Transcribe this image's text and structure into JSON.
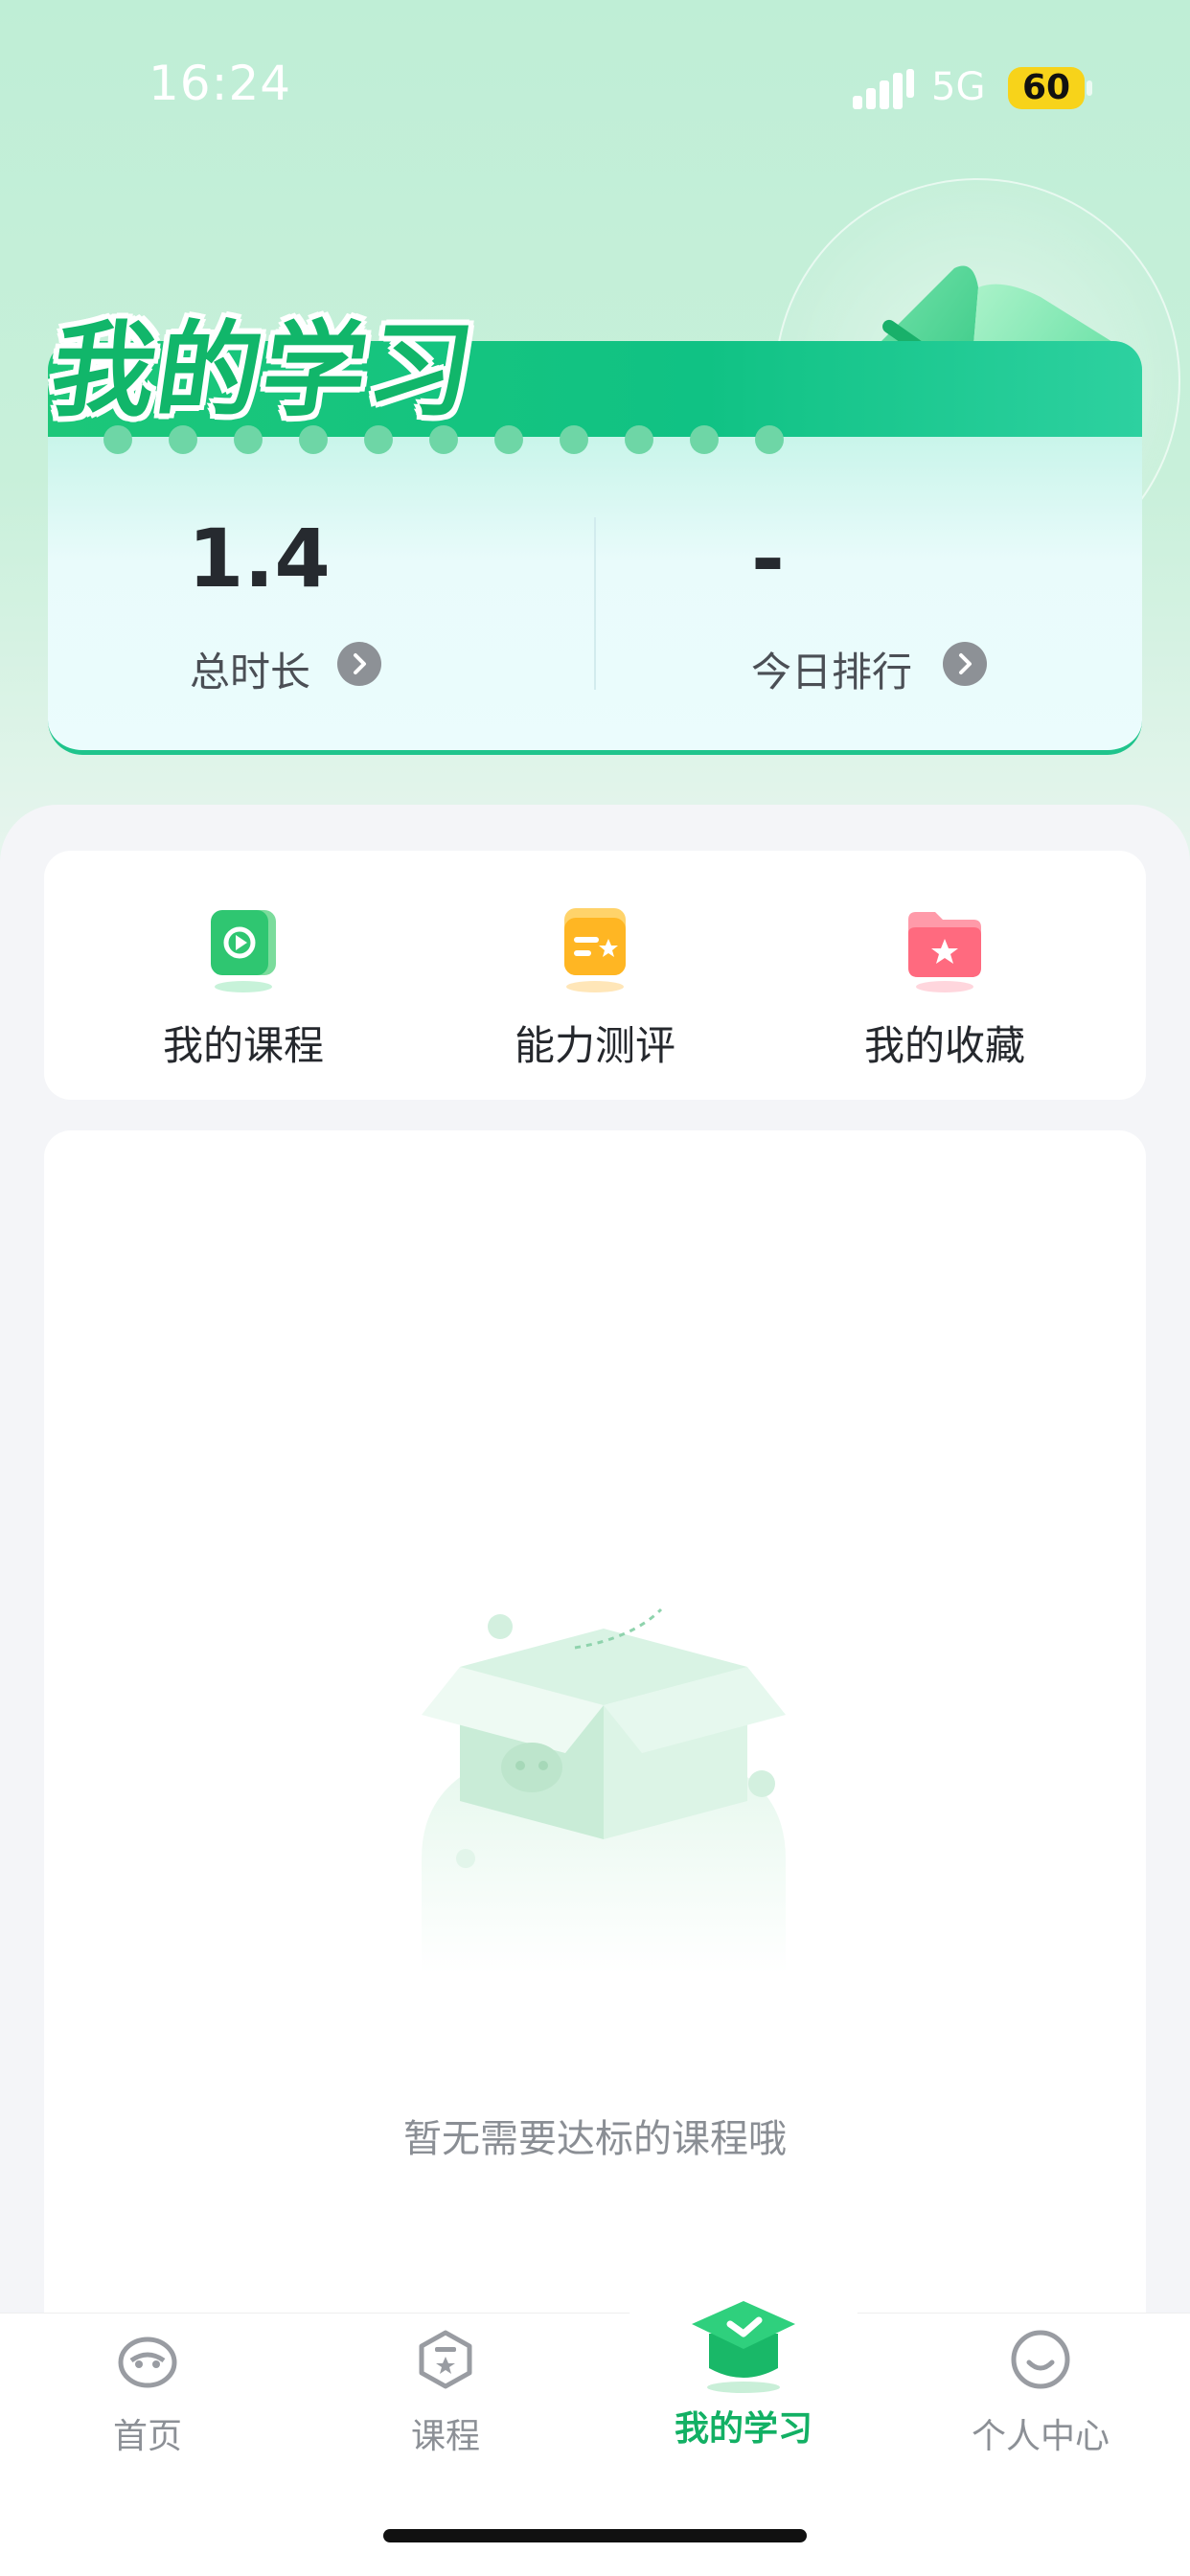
{
  "status_bar": {
    "time": "16:24",
    "network": "5G",
    "battery": "60"
  },
  "header": {
    "title": "我的学习",
    "stats": [
      {
        "value": "1.4",
        "label": "总时长"
      },
      {
        "value": "-",
        "label": "今日排行"
      }
    ]
  },
  "quick_actions": [
    {
      "label": "我的课程",
      "icon": "video-play-icon",
      "color": "#2fc671"
    },
    {
      "label": "能力测评",
      "icon": "evaluation-icon",
      "color": "#ffb623"
    },
    {
      "label": "我的收藏",
      "icon": "favorite-folder-icon",
      "color": "#ff6a7f"
    }
  ],
  "empty_state": {
    "text": "暂无需要达标的课程哦",
    "icon": "empty-box-icon"
  },
  "tabbar": {
    "active": 2,
    "items": [
      {
        "label": "首页",
        "icon": "home-icon"
      },
      {
        "label": "课程",
        "icon": "course-icon"
      },
      {
        "label": "我的学习",
        "icon": "graduation-cap-icon"
      },
      {
        "label": "个人中心",
        "icon": "profile-icon"
      }
    ]
  },
  "colors": {
    "accent": "#12b064",
    "header_bg": "#bfeed6"
  }
}
